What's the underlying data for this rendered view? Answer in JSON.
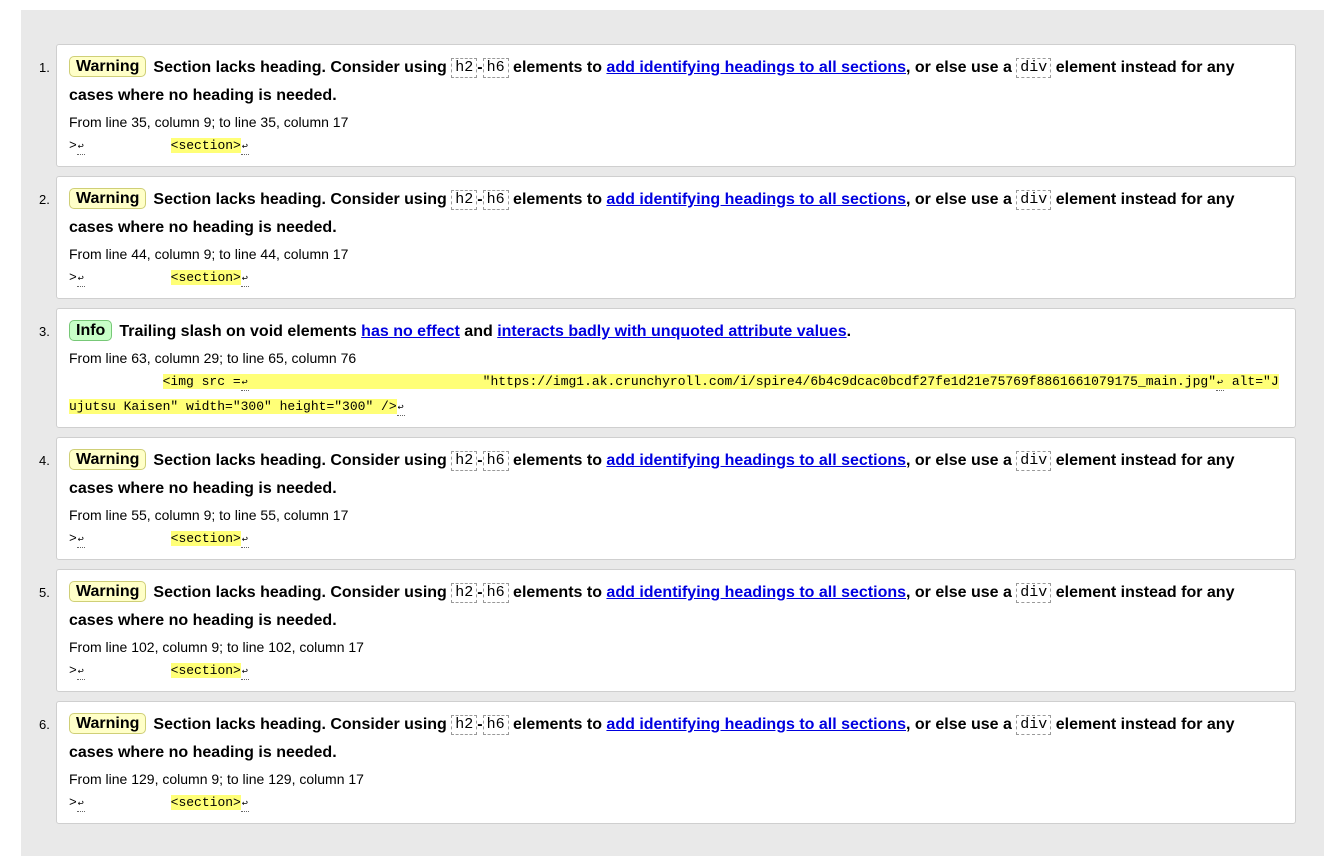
{
  "messages": [
    {
      "number": "1.",
      "type": "Warning",
      "kind": "warning",
      "text_a": "Section lacks heading. Consider using ",
      "code_a": "h2",
      "dash": "-",
      "code_b": "h6",
      "text_b": " elements to ",
      "link": "add identifying headings to all sections",
      "text_c": ", or else use a ",
      "code_c": "div",
      "text_d": " element instead for any cases where no heading is needed.",
      "location": "From line 35, column 9; to line 35, column 17",
      "extract_pre": ">",
      "extract_gap": "           ",
      "extract_hl": "<section>"
    },
    {
      "number": "2.",
      "type": "Warning",
      "kind": "warning",
      "text_a": "Section lacks heading. Consider using ",
      "code_a": "h2",
      "dash": "-",
      "code_b": "h6",
      "text_b": " elements to ",
      "link": "add identifying headings to all sections",
      "text_c": ", or else use a ",
      "code_c": "div",
      "text_d": " element instead for any cases where no heading is needed.",
      "location": "From line 44, column 9; to line 44, column 17",
      "extract_pre": ">",
      "extract_gap": "           ",
      "extract_hl": "<section>"
    },
    {
      "number": "3.",
      "type": "Info",
      "kind": "info",
      "text_a": "Trailing slash on void elements ",
      "link_a": "has no effect",
      "text_b": " and ",
      "link_b": "interacts badly with unquoted attribute values",
      "text_c": ".",
      "location": "From line 63, column 29; to line 65, column 76",
      "extract_gap": "            ",
      "extract_hl_1": "<img src =",
      "extract_hl_2": "                              \"https://img1.ak.crunchyroll.com/i/spire4/6b4c9dcac0bcdf27fe1d21e75769f8861661079175_main.jpg\"",
      "extract_hl_3": "alt=\"Jujutsu Kaisen\" width=\"300\" height=\"300\" />"
    },
    {
      "number": "4.",
      "type": "Warning",
      "kind": "warning",
      "text_a": "Section lacks heading. Consider using ",
      "code_a": "h2",
      "dash": "-",
      "code_b": "h6",
      "text_b": " elements to ",
      "link": "add identifying headings to all sections",
      "text_c": ", or else use a ",
      "code_c": "div",
      "text_d": " element instead for any cases where no heading is needed.",
      "location": "From line 55, column 9; to line 55, column 17",
      "extract_pre": ">",
      "extract_gap": "           ",
      "extract_hl": "<section>"
    },
    {
      "number": "5.",
      "type": "Warning",
      "kind": "warning",
      "text_a": "Section lacks heading. Consider using ",
      "code_a": "h2",
      "dash": "-",
      "code_b": "h6",
      "text_b": " elements to ",
      "link": "add identifying headings to all sections",
      "text_c": ", or else use a ",
      "code_c": "div",
      "text_d": " element instead for any cases where no heading is needed.",
      "location": "From line 102, column 9; to line 102, column 17",
      "extract_pre": ">",
      "extract_gap": "           ",
      "extract_hl": "<section>"
    },
    {
      "number": "6.",
      "type": "Warning",
      "kind": "warning",
      "text_a": "Section lacks heading. Consider using ",
      "code_a": "h2",
      "dash": "-",
      "code_b": "h6",
      "text_b": " elements to ",
      "link": "add identifying headings to all sections",
      "text_c": ", or else use a ",
      "code_c": "div",
      "text_d": " element instead for any cases where no heading is needed.",
      "location": "From line 129, column 9; to line 129, column 17",
      "extract_pre": ">",
      "extract_gap": "           ",
      "extract_hl": "<section>"
    }
  ],
  "return_glyph": "↩",
  "colors": {
    "warning_badge": "#ffffc8",
    "info_badge": "#c8ffc8",
    "extract_highlight": "#ffff77",
    "link": "#0000e0",
    "panel_background": "#e9e9e9"
  }
}
